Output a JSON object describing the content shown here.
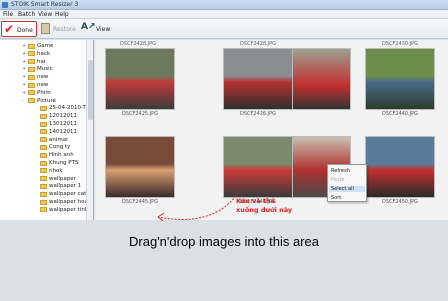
{
  "window": {
    "title": "STOIK Smart Resizer 3"
  },
  "menu": [
    "File",
    "Batch",
    "View",
    "Help"
  ],
  "toolbar": {
    "done_label": "Done",
    "restore_label": "Restore",
    "view_label": "View"
  },
  "tree": [
    {
      "label": "Game",
      "indent": 0,
      "exp": "+"
    },
    {
      "label": "hack",
      "indent": 0,
      "exp": "+"
    },
    {
      "label": "hai",
      "indent": 0,
      "exp": "+"
    },
    {
      "label": "Music",
      "indent": 0,
      "exp": "+"
    },
    {
      "label": "new",
      "indent": 0,
      "exp": "+"
    },
    {
      "label": "new",
      "indent": 0,
      "exp": "+"
    },
    {
      "label": "Phim",
      "indent": 0,
      "exp": "+"
    },
    {
      "label": "Picture",
      "indent": 0,
      "exp": "-"
    },
    {
      "label": "25-04-2010-TRI",
      "indent": 1,
      "exp": ""
    },
    {
      "label": "12012011",
      "indent": 1,
      "exp": ""
    },
    {
      "label": "13012011",
      "indent": 1,
      "exp": ""
    },
    {
      "label": "14012011",
      "indent": 1,
      "exp": ""
    },
    {
      "label": "animal",
      "indent": 1,
      "exp": ""
    },
    {
      "label": "Cong ty",
      "indent": 1,
      "exp": ""
    },
    {
      "label": "Hinh anh",
      "indent": 1,
      "exp": ""
    },
    {
      "label": "Khung PTS",
      "indent": 1,
      "exp": ""
    },
    {
      "label": "nhok",
      "indent": 1,
      "exp": ""
    },
    {
      "label": "wallpaper",
      "indent": 1,
      "exp": ""
    },
    {
      "label": "wallpaper 1",
      "indent": 1,
      "exp": ""
    },
    {
      "label": "wallpaper cat",
      "indent": 1,
      "exp": ""
    },
    {
      "label": "wallpaper hoat",
      "indent": 1,
      "exp": ""
    },
    {
      "label": "wallpaper tinh",
      "indent": 1,
      "exp": ""
    }
  ],
  "thumbnails_top": [
    "DSCF2428.JPG",
    "DSCF2428.JPG",
    "DSCF2430.JPG"
  ],
  "thumbnails": [
    {
      "caption": "DSCF2425.JPG"
    },
    {
      "caption": "DSCF2426.JPG"
    },
    {
      "caption": ""
    },
    {
      "caption": "DSCF2440.JPG"
    },
    {
      "caption": "DSCF2445.JPG"
    },
    {
      "caption": "DSCF2446.JPG"
    },
    {
      "caption": ""
    },
    {
      "caption": "DSCF2450.JPG"
    }
  ],
  "context_menu": [
    "Refresh",
    "Paste",
    "Select all",
    "Sort"
  ],
  "dropzone": {
    "text": "Drag'n'drop images into this area",
    "note_line1": "Kéo và thả",
    "note_line2": "xuống dưới này"
  },
  "colors": {
    "accent_red": "#e02020",
    "done_border": "#c0392b"
  }
}
